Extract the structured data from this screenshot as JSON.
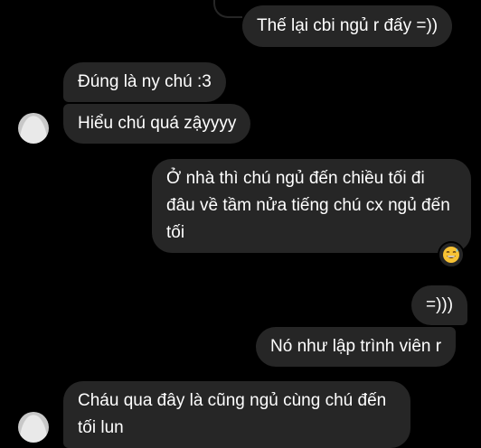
{
  "messages": [
    {
      "text": "Thế lại cbi ngủ r đấy =))"
    },
    {
      "text": "Đúng là ny chú :3"
    },
    {
      "text": "Hiểu chú quá zậyyyy"
    },
    {
      "text": "Ở nhà thì chú ngủ đến chiều tối đi đâu về tầm nửa tiếng chú cx ngủ đến tối"
    },
    {
      "text": "=)))"
    },
    {
      "text": "Nó như lập trình viên r"
    },
    {
      "text": "Cháu qua đây là cũng ngủ cùng chú đến tối lun"
    }
  ],
  "reaction": {
    "icon": "grinning-sweat-emoji"
  }
}
